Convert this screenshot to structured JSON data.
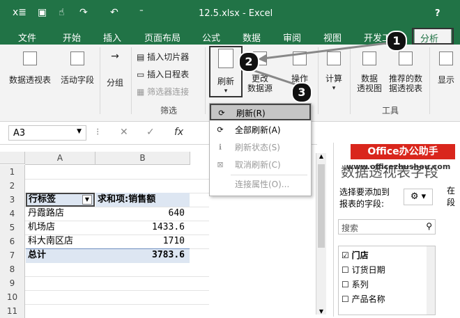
{
  "window": {
    "title": "12.5.xlsx - Excel",
    "help": "?"
  },
  "tabs": [
    "文件",
    "开始",
    "插入",
    "页面布局",
    "公式",
    "数据",
    "审阅",
    "视图",
    "开发工",
    "分析"
  ],
  "ribbon": {
    "pivot_table": "数据透视表",
    "active_field": "活动字段",
    "group": "分组",
    "insert_slicer": "插入切片器",
    "insert_timeline": "插入日程表",
    "filter_connections": "筛选器连接",
    "filter_group": "筛选",
    "refresh": "刷新",
    "change_source_1": "更改",
    "change_source_2": "数据源",
    "operations": "操作",
    "calculations": "计算",
    "pivot_chart_1": "数据",
    "pivot_chart_2": "透视图",
    "recommended_1": "推荐的数",
    "recommended_2": "据透视表",
    "show": "显示",
    "tools_group": "工具"
  },
  "refresh_menu": {
    "items": [
      "刷新(R)",
      "全部刷新(A)",
      "刷新状态(S)",
      "取消刷新(C)",
      "连接属性(O)..."
    ]
  },
  "formula_bar": {
    "name_box": "A3",
    "fx": "fx"
  },
  "grid": {
    "columns": [
      "A",
      "B"
    ],
    "rows": [
      "1",
      "2",
      "3",
      "4",
      "5",
      "6",
      "7",
      "8",
      "9",
      "10",
      "11"
    ],
    "header_a": "行标签",
    "header_b": "求和项:销售额",
    "data": [
      {
        "label": "丹霞路店",
        "value": "640"
      },
      {
        "label": "机场店",
        "value": "1433.6"
      },
      {
        "label": "科大南区店",
        "value": "1710"
      }
    ],
    "total_label": "总计",
    "total_value": "3783.6"
  },
  "pane": {
    "title": "数据透视表字段",
    "watermark_1": "Office办公助手",
    "watermark_2": "www.officezhushou.com",
    "choose_fields_1": "选择要添加到",
    "choose_fields_2": "报表的字段:",
    "search": "搜索",
    "fields": [
      "门店",
      "订货日期",
      "系列",
      "产品名称"
    ],
    "right_cut_1": "在",
    "right_cut_2": "段"
  },
  "callouts": [
    "1",
    "2",
    "3"
  ],
  "colors": {
    "excel_green": "#217346",
    "ribbon_bg": "#f3f3f3",
    "watermark_red": "#d9261c"
  }
}
